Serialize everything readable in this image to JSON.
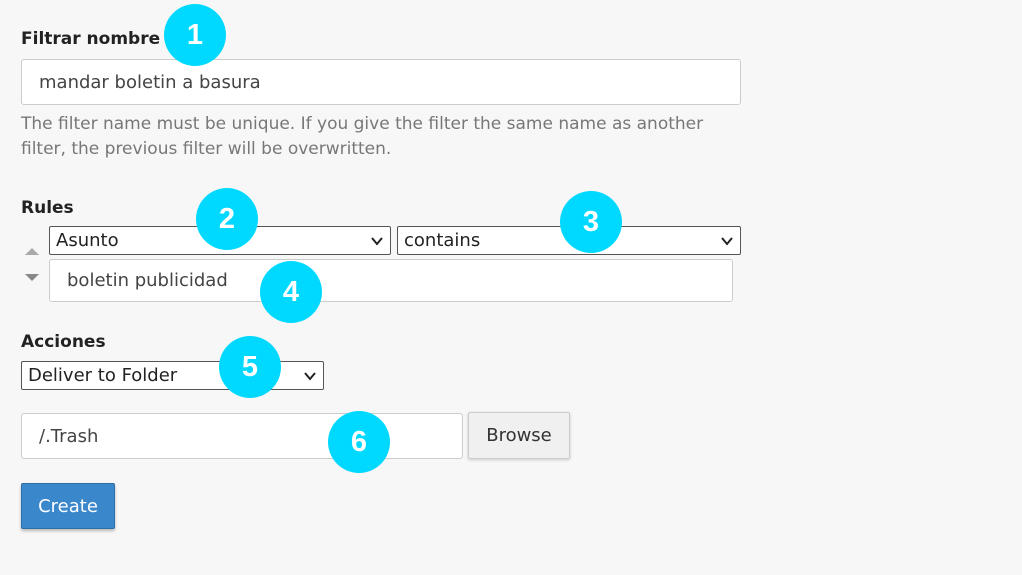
{
  "filter": {
    "label": "Filtrar nombre",
    "value": "mandar boletin a basura",
    "help": "The filter name must be unique. If you give the filter the same name as another filter, the previous filter will be overwritten."
  },
  "rules": {
    "label": "Rules",
    "field_select": "Asunto",
    "operator_select": "contains",
    "value": "boletin publicidad"
  },
  "actions": {
    "label": "Acciones",
    "action_select": "Deliver to Folder",
    "folder_value": "/.Trash",
    "browse_label": "Browse"
  },
  "create_label": "Create",
  "badges": [
    "1",
    "2",
    "3",
    "4",
    "5",
    "6"
  ],
  "colors": {
    "badge": "#00d9ff",
    "create_button": "#3b87cc",
    "background": "#f7f7f7"
  },
  "icons": [
    "move-up-arrow-icon",
    "move-down-arrow-icon",
    "chevron-down-icon"
  ]
}
